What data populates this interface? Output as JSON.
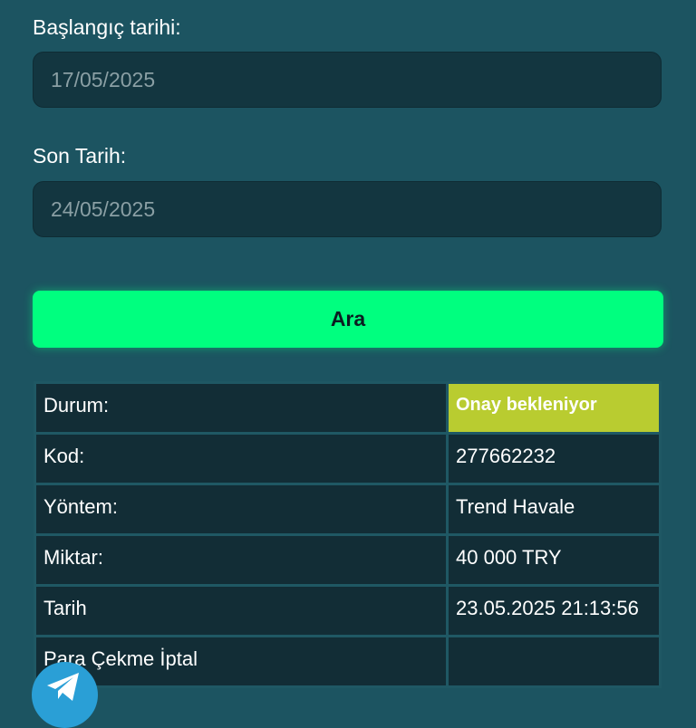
{
  "form": {
    "start_label": "Başlangıç tarihi:",
    "start_value": "17/05/2025",
    "end_label": "Son Tarih:",
    "end_value": "24/05/2025",
    "search_label": "Ara"
  },
  "details": {
    "rows": [
      {
        "label": "Durum:",
        "value": "Onay bekleniyor"
      },
      {
        "label": "Kod:",
        "value": "277662232"
      },
      {
        "label": "Yöntem:",
        "value": "Trend Havale"
      },
      {
        "label": "Miktar:",
        "value": "40 000 TRY"
      },
      {
        "label": "Tarih",
        "value": "23.05.2025 21:13:56"
      },
      {
        "label": "Para Çekme İptal",
        "value": ""
      }
    ]
  },
  "icons": {
    "telegram": "telegram-icon"
  },
  "colors": {
    "background": "#1c5461",
    "input_bg": "#133640",
    "button_bg": "#00ff7f",
    "status_bg": "#b9cc30",
    "cell_bg": "#122d36",
    "telegram_blue": "#2a9fd6"
  }
}
